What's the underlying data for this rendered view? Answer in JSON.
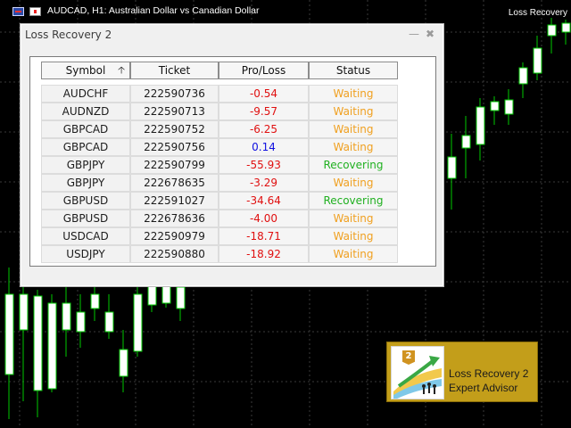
{
  "chart": {
    "title": "AUDCAD, H1:  Australian Dollar vs Canadian Dollar",
    "ea_label": "Loss Recovery",
    "colors": {
      "background": "#000000",
      "grid": "#3a3a3a",
      "candle_body": "#ffffff",
      "candle_wick": "#00c800"
    }
  },
  "dialog": {
    "title": "Loss Recovery 2",
    "minimize_icon": "minimize-icon",
    "close_icon": "close-icon",
    "columns": [
      "Symbol",
      "Ticket",
      "Pro/Loss",
      "Status"
    ],
    "sort_column": "Symbol",
    "sort_icon": "sort-arrow-up-icon",
    "rows": [
      {
        "symbol": "AUDCHF",
        "ticket": "222590736",
        "pl": "-0.54",
        "status": "Waiting"
      },
      {
        "symbol": "AUDNZD",
        "ticket": "222590713",
        "pl": "-9.57",
        "status": "Waiting"
      },
      {
        "symbol": "GBPCAD",
        "ticket": "222590752",
        "pl": "-6.25",
        "status": "Waiting"
      },
      {
        "symbol": "GBPCAD",
        "ticket": "222590756",
        "pl": "0.14",
        "status": "Waiting"
      },
      {
        "symbol": "GBPJPY",
        "ticket": "222590799",
        "pl": "-55.93",
        "status": "Recovering"
      },
      {
        "symbol": "GBPJPY",
        "ticket": "222678635",
        "pl": "-3.29",
        "status": "Waiting"
      },
      {
        "symbol": "GBPUSD",
        "ticket": "222591027",
        "pl": "-34.64",
        "status": "Recovering"
      },
      {
        "symbol": "GBPUSD",
        "ticket": "222678636",
        "pl": "-4.00",
        "status": "Waiting"
      },
      {
        "symbol": "USDCAD",
        "ticket": "222590979",
        "pl": "-18.71",
        "status": "Waiting"
      },
      {
        "symbol": "USDJPY",
        "ticket": "222590880",
        "pl": "-18.92",
        "status": "Waiting"
      }
    ],
    "colors": {
      "negative": "#e01010",
      "positive": "#1010e0",
      "waiting": "#f0a020",
      "recovering": "#20b020"
    }
  },
  "logo": {
    "badge": "2",
    "line1": "Loss Recovery 2",
    "line2": "Expert Advisor",
    "bg_color": "#c39e1a"
  }
}
